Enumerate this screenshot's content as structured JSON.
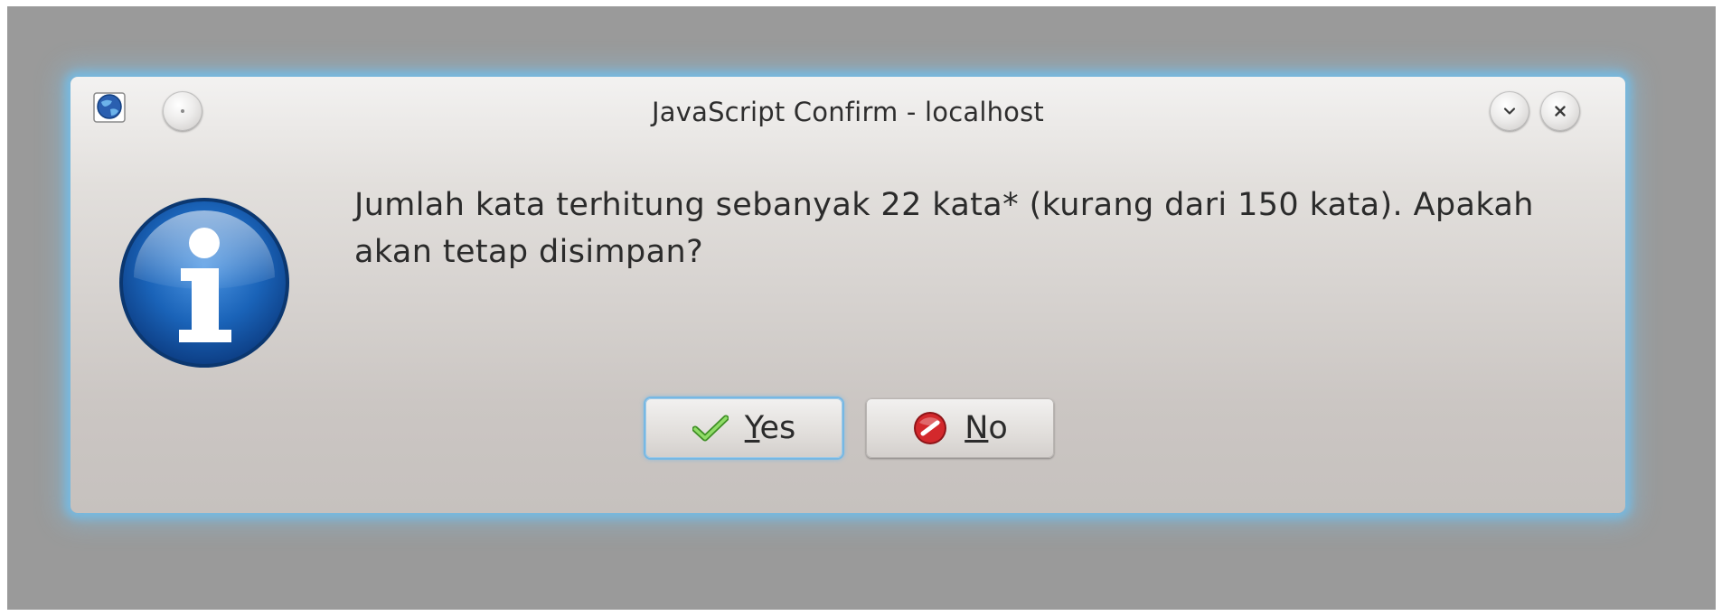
{
  "window": {
    "title": "JavaScript Confirm - localhost"
  },
  "message": {
    "line1": "Jumlah kata terhitung sebanyak 22 kata* (kurang dari 150 kata). Apakah",
    "line2": "akan tetap disimpan?"
  },
  "buttons": {
    "yes": {
      "mnemonic": "Y",
      "rest": "es",
      "icon": "check-icon"
    },
    "no": {
      "mnemonic": "N",
      "rest": "o",
      "icon": "stop-icon"
    }
  },
  "icons": {
    "app": "globe-icon",
    "dialog": "info-icon",
    "menu": "window-menu-icon",
    "minimize": "chevron-down-icon",
    "close": "close-icon"
  },
  "colors": {
    "focus_glow": "#76b8e4",
    "info_blue": "#1a63b8",
    "check_green": "#5cbf3a",
    "stop_red": "#c8262a"
  }
}
